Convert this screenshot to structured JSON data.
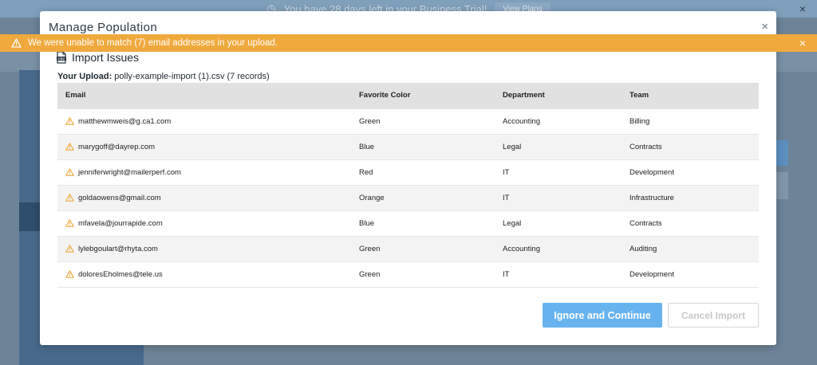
{
  "background": {
    "trial_text": "You have 28 days left in your Business Trial!",
    "trial_button": "View Plans"
  },
  "modal": {
    "title": "Manage Population",
    "close_symbol": "×"
  },
  "alert": {
    "message": "We were unable to match (7) email addresses in your upload.",
    "close_symbol": "×",
    "color": "#f0a93d"
  },
  "issues": {
    "title": "Import Issues",
    "upload_label": "Your Upload:",
    "upload_value": "polly-example-import (1).csv (7 records)"
  },
  "table": {
    "headers": [
      "Email",
      "Favorite Color",
      "Department",
      "Team"
    ],
    "rows": [
      {
        "email": "matthewmweis@g.ca1.com",
        "color": "Green",
        "department": "Accounting",
        "team": "Billing"
      },
      {
        "email": "marygoff@dayrep.com",
        "color": "Blue",
        "department": "Legal",
        "team": "Contracts"
      },
      {
        "email": "jenniferwright@mailerperf.com",
        "color": "Red",
        "department": "IT",
        "team": "Development"
      },
      {
        "email": "goldaowens@gmail.com",
        "color": "Orange",
        "department": "IT",
        "team": "Infrastructure"
      },
      {
        "email": "mfavela@jourrapide.com",
        "color": "Blue",
        "department": "Legal",
        "team": "Contracts"
      },
      {
        "email": "lylebgoulart@rhyta.com",
        "color": "Green",
        "department": "Accounting",
        "team": "Auditing"
      },
      {
        "email": "doloresEholmes@tele.us",
        "color": "Green",
        "department": "IT",
        "team": "Development"
      }
    ]
  },
  "buttons": {
    "ignore": "Ignore and Continue",
    "cancel": "Cancel Import",
    "accent": "#67b3f0"
  },
  "icons": {
    "row_warning": "warning-triangle-icon",
    "alert_warning": "warning-triangle-icon",
    "doc": "csv-document-icon"
  }
}
